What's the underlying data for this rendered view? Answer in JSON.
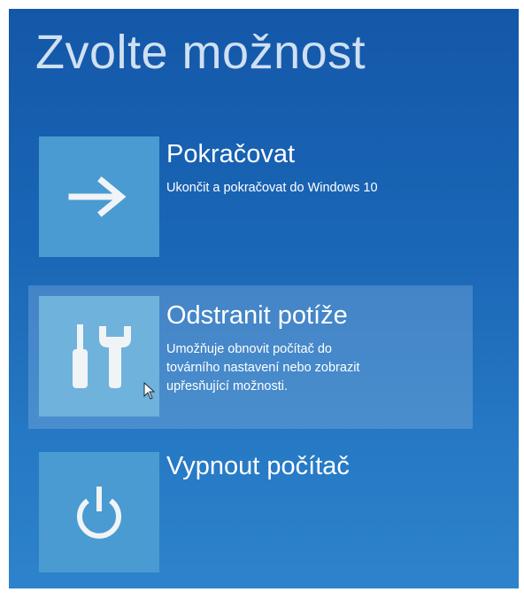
{
  "screen": {
    "title": "Zvolte možnost"
  },
  "options": [
    {
      "title": "Pokračovat",
      "description_lines": [
        "Ukončit a pokračovat do Windows 10"
      ],
      "icon": "arrow-right-icon"
    },
    {
      "title": "Odstranit potíže",
      "description_lines": [
        "Umožňuje obnovit počítač do",
        "továrního nastavení nebo zobrazit",
        "upřesňující možnosti."
      ],
      "icon": "tools-icon"
    },
    {
      "title": "Vypnout počítač",
      "description_lines": [],
      "icon": "power-icon"
    }
  ],
  "colors": {
    "background": "#1a66b6",
    "tile": "#4a9bd1",
    "tile_hover": "#6fb2dc",
    "icon": "#f0f4f6",
    "title_text": "#cfe0f2"
  }
}
